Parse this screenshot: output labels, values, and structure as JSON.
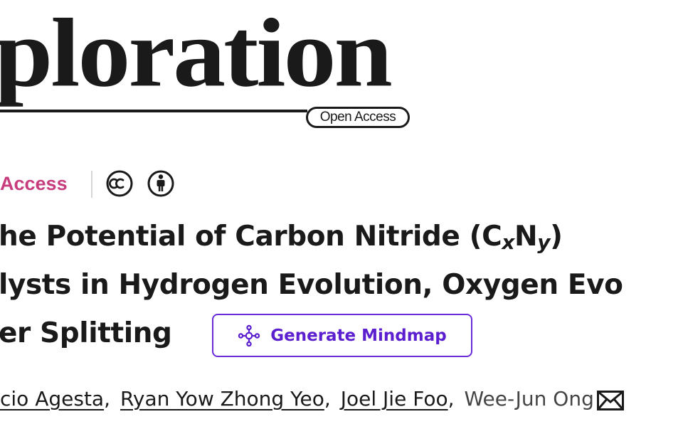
{
  "journal": {
    "logo_text": "ploration",
    "open_access_pill": "Open Access"
  },
  "access": {
    "label": "Access",
    "icons": [
      "creative-commons-icon",
      "attribution-person-icon"
    ]
  },
  "article": {
    "title_line1_pre": "he Potential of Carbon Nitride (C",
    "title_sub_x": "x",
    "title_mid": "N",
    "title_sub_y": "y",
    "title_line1_post": ")",
    "title_line2": "lysts in Hydrogen Evolution, Oxygen Evo",
    "title_line3": "er Splitting"
  },
  "mindmap_button": {
    "label": "Generate Mindmap",
    "icon": "mindmap-icon"
  },
  "authors": [
    {
      "name": "cio Agesta",
      "linked": true
    },
    {
      "name": "Ryan Yow Zhong Yeo",
      "linked": true
    },
    {
      "name": "Joel Jie Foo",
      "linked": true
    },
    {
      "name": "Wee-Jun Ong",
      "linked": false
    }
  ],
  "author_separator": ",",
  "colors": {
    "open_access_accent": "#c63c7d",
    "button_accent": "#5b1fd0",
    "text": "#1a1a1a"
  }
}
